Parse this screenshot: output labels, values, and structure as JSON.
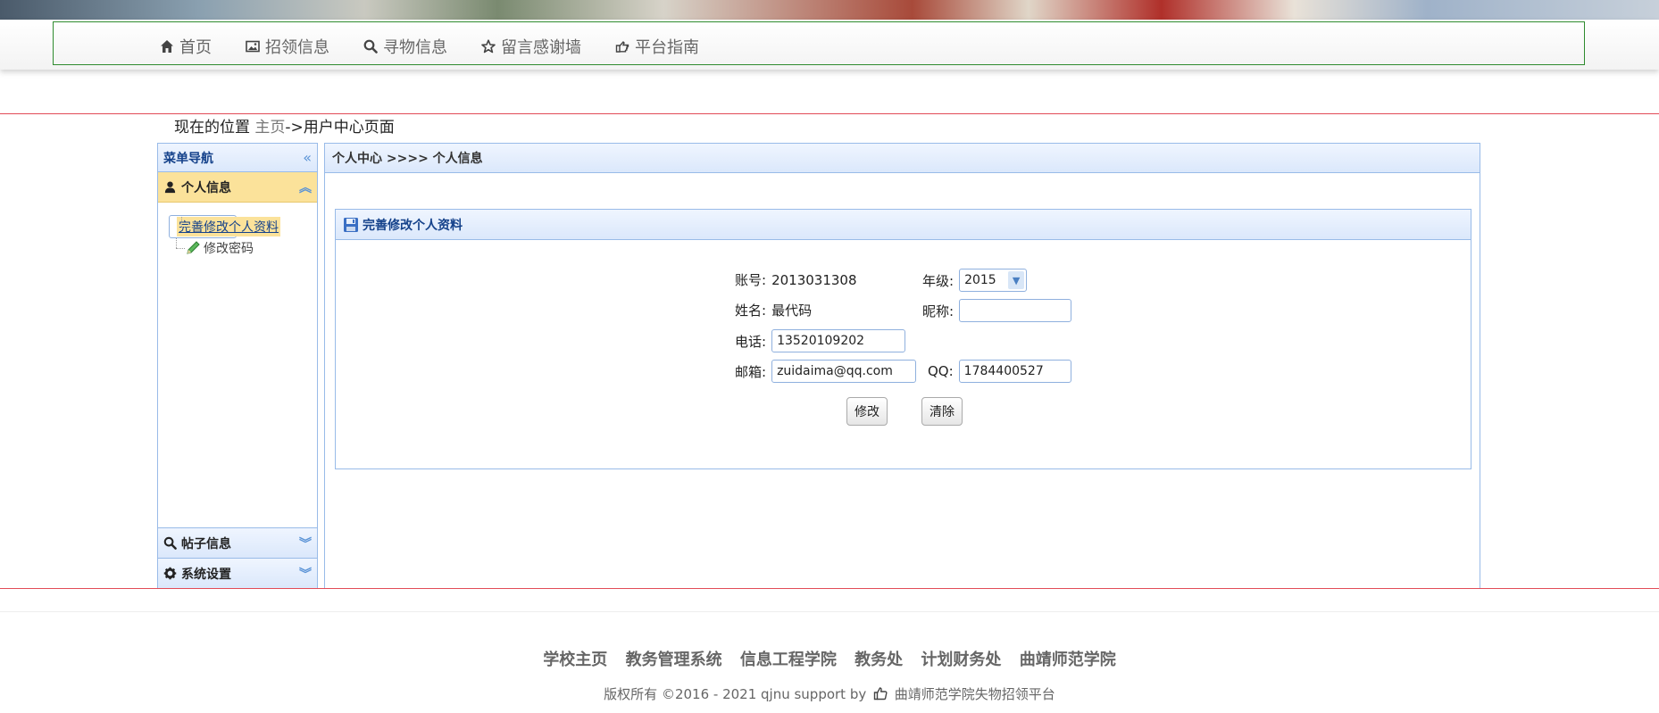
{
  "nav": {
    "items": [
      {
        "label": "首页",
        "icon": "home-icon"
      },
      {
        "label": "招领信息",
        "icon": "picture-icon"
      },
      {
        "label": "寻物信息",
        "icon": "search-icon"
      },
      {
        "label": "留言感谢墙",
        "icon": "star-icon"
      },
      {
        "label": "平台指南",
        "icon": "hand-pointing-icon"
      }
    ]
  },
  "breadcrumb": {
    "prefix": "现在的位置",
    "home": "主页",
    "rest": "->用户中心页面"
  },
  "sidebar": {
    "title": "菜单导航",
    "sections": {
      "personal": "个人信息",
      "posts": "帖子信息",
      "settings": "系统设置"
    },
    "items": [
      {
        "label": "完善修改个人资料",
        "icon": "save-disk-icon"
      },
      {
        "label": "修改密码",
        "icon": "pencil-icon"
      }
    ]
  },
  "main": {
    "title": "个人中心 >>>> 个人信息",
    "form_title": "完善修改个人资料",
    "fields": {
      "account_label": "账号:",
      "account_value": "2013031308",
      "grade_label": "年级:",
      "grade_value": "2015",
      "name_label": "姓名:",
      "name_value": "最代码",
      "nickname_label": "昵称:",
      "nickname_value": "",
      "phone_label": "电话:",
      "phone_value": "13520109202",
      "email_label": "邮箱:",
      "email_value": "zuidaima@qq.com",
      "qq_label": "QQ:",
      "qq_value": "1784400527"
    },
    "buttons": {
      "modify": "修改",
      "clear": "清除"
    }
  },
  "footer": {
    "links": [
      "学校主页",
      "教务管理系统",
      "信息工程学院",
      "教务处",
      "计划财务处",
      "曲靖师范学院"
    ],
    "copyright_pre": "版权所有 ©2016 - 2021 qjnu support by",
    "copyright_post": "曲靖师范学院失物招领平台"
  }
}
